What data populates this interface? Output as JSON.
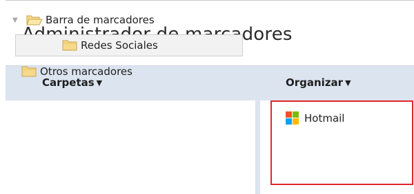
{
  "window": {
    "title": "Administrador de marcadores"
  },
  "toolbar": {
    "folders_menu": "Carpetas",
    "organize_menu": "Organizar"
  },
  "tree": {
    "items": [
      {
        "label": "Barra de marcadores",
        "expanded": true
      },
      {
        "label": "Redes Sociales",
        "selected": true
      },
      {
        "label": "Otros marcadores"
      }
    ]
  },
  "bookmarks": {
    "items": [
      {
        "label": "Hotmail",
        "icon": "microsoft-logo-icon"
      }
    ]
  },
  "colors": {
    "toolbar_bg": "#dbe4ef",
    "highlight_border": "#e0252b",
    "folder_fill": "#f6d98b",
    "folder_stroke": "#c9a44a",
    "ms_red": "#f25022",
    "ms_green": "#7fba00",
    "ms_blue": "#00a4ef",
    "ms_yellow": "#ffb900"
  }
}
